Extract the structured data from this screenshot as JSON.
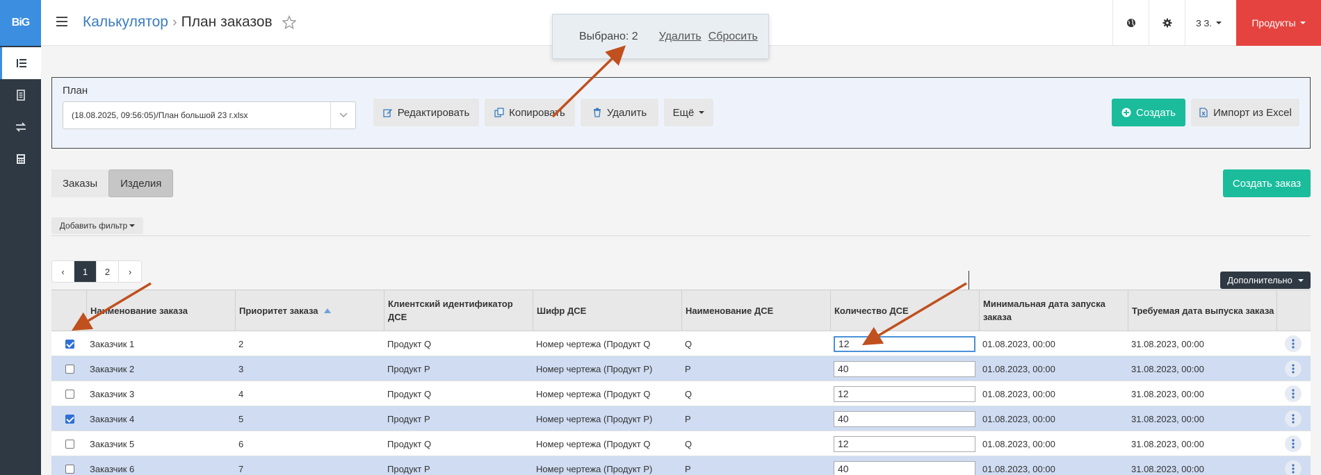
{
  "sidebar": {
    "logo": "BiG"
  },
  "header": {
    "breadcrumb_parent": "Калькулятор",
    "breadcrumb_sep": "›",
    "breadcrumb_current": "План заказов",
    "user": "З З.",
    "products": "Продукты"
  },
  "toast": {
    "selected": "Выбрано: 2",
    "delete": "Удалить",
    "reset": "Сбросить"
  },
  "plan": {
    "label": "План",
    "selected": "(18.08.2025, 09:56:05)/План большой 23 г.xlsx",
    "edit": "Редактировать",
    "copy": "Копировать",
    "delete": "Удалить",
    "more": "Ещё",
    "create": "Создать",
    "import": "Импорт из Excel"
  },
  "tabs": {
    "orders": "Заказы",
    "products": "Изделия"
  },
  "create_order": "Создать заказ",
  "filter": "Добавить фильтр",
  "pager": {
    "prev": "‹",
    "pages": [
      "1",
      "2"
    ],
    "next": "›"
  },
  "extra": "Дополнительно",
  "columns": [
    "Наименование заказа",
    "Приоритет заказа",
    "Клиентский идентификатор ДСЕ",
    "Шифр ДСЕ",
    "Наименование ДСЕ",
    "Количество ДСЕ",
    "Минимальная дата запуска заказа",
    "Требуемая дата выпуска заказа"
  ],
  "rows": [
    {
      "checked": true,
      "name": "Заказчик 1",
      "priority": "2",
      "client_id": "Продукт Q",
      "code": "Номер чертежа (Продукт Q",
      "dse": "Q",
      "qty": "12",
      "min_date": "01.08.2023, 00:00",
      "req_date": "31.08.2023, 00:00"
    },
    {
      "checked": false,
      "name": "Заказчик 2",
      "priority": "3",
      "client_id": "Продукт P",
      "code": "Номер чертежа (Продукт P)",
      "dse": "P",
      "qty": "40",
      "min_date": "01.08.2023, 00:00",
      "req_date": "31.08.2023, 00:00"
    },
    {
      "checked": false,
      "name": "Заказчик 3",
      "priority": "4",
      "client_id": "Продукт Q",
      "code": "Номер чертежа (Продукт Q",
      "dse": "Q",
      "qty": "12",
      "min_date": "01.08.2023, 00:00",
      "req_date": "31.08.2023, 00:00"
    },
    {
      "checked": true,
      "name": "Заказчик 4",
      "priority": "5",
      "client_id": "Продукт P",
      "code": "Номер чертежа (Продукт P)",
      "dse": "P",
      "qty": "40",
      "min_date": "01.08.2023, 00:00",
      "req_date": "31.08.2023, 00:00"
    },
    {
      "checked": false,
      "name": "Заказчик 5",
      "priority": "6",
      "client_id": "Продукт Q",
      "code": "Номер чертежа (Продукт Q",
      "dse": "Q",
      "qty": "12",
      "min_date": "01.08.2023, 00:00",
      "req_date": "31.08.2023, 00:00"
    },
    {
      "checked": false,
      "name": "Заказчик 6",
      "priority": "7",
      "client_id": "Продукт P",
      "code": "Номер чертежа (Продукт P)",
      "dse": "P",
      "qty": "40",
      "min_date": "01.08.2023, 00:00",
      "req_date": "31.08.2023, 00:00"
    }
  ]
}
